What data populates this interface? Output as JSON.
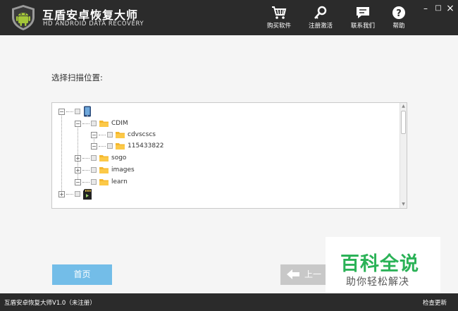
{
  "header": {
    "title": "互盾安卓恢复大师",
    "subtitle": "HD ANDROID DATA RECOVERY",
    "logo_icon": "android-shield-icon",
    "nav": [
      {
        "label": "购买软件",
        "icon": "shopping-cart-icon"
      },
      {
        "label": "注册激活",
        "icon": "key-icon"
      },
      {
        "label": "联系我们",
        "icon": "chat-icon"
      },
      {
        "label": "帮助",
        "icon": "help-icon"
      }
    ],
    "window_controls": {
      "minimize": "–",
      "maximize": "□",
      "close": "×"
    }
  },
  "main": {
    "prompt": "选择扫描位置:",
    "tree": [
      {
        "label": "",
        "icon": "phone-icon",
        "expander": "−"
      },
      {
        "label": "CDIM",
        "icon": "folder-icon",
        "expander": "−"
      },
      {
        "label": "cdvscscs",
        "icon": "folder-icon",
        "expander": "−"
      },
      {
        "label": "115433822",
        "icon": "folder-icon",
        "expander": "−"
      },
      {
        "label": "sogo",
        "icon": "folder-icon",
        "expander": "+"
      },
      {
        "label": "images",
        "icon": "folder-icon",
        "expander": "+"
      },
      {
        "label": "learn",
        "icon": "folder-icon",
        "expander": "−"
      },
      {
        "label": "",
        "icon": "sd-card-icon",
        "expander": "+"
      }
    ],
    "home_button": "首页",
    "prev_button": "上一"
  },
  "watermark": {
    "title": "百科全说",
    "subtitle": "助你轻松解决"
  },
  "status": {
    "text": "互盾安卓恢复大师V1.0（未注册）",
    "update": "检查更新"
  },
  "colors": {
    "header_bg": "#2b2b2b",
    "home_button": "#73bde8",
    "folder": "#f5b72c",
    "watermark_green": "#2bb257"
  }
}
